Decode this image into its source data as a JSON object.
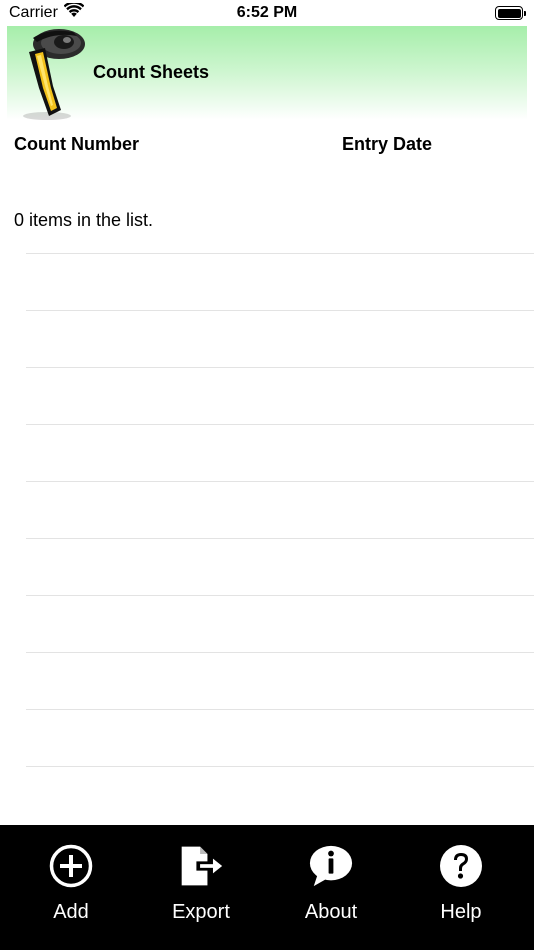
{
  "status_bar": {
    "carrier": "Carrier",
    "time": "6:52 PM"
  },
  "header": {
    "title": "Count Sheets",
    "icon": "barcode-scanner-icon"
  },
  "columns": {
    "count_number": "Count Number",
    "entry_date": "Entry Date"
  },
  "list": {
    "summary": "0 items in the list.",
    "rows": 10
  },
  "tab_bar": {
    "items": [
      {
        "label": "Add",
        "icon": "plus-circle-icon"
      },
      {
        "label": "Export",
        "icon": "export-icon"
      },
      {
        "label": "About",
        "icon": "info-bubble-icon"
      },
      {
        "label": "Help",
        "icon": "help-icon"
      }
    ]
  },
  "colors": {
    "header_gradient_top": "#a6eeaa",
    "tab_bar_bg": "#000000",
    "divider": "#e3e3e3"
  }
}
